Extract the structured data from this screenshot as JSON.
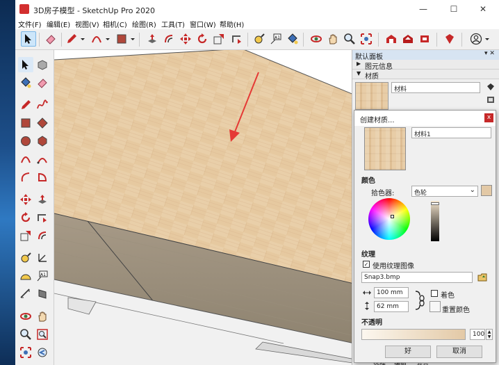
{
  "window": {
    "title": "3D房子模型 - SketchUp Pro 2020",
    "minimize_icon": "—",
    "maximize_icon": "☐",
    "close_icon": "✕"
  },
  "menu": [
    "文件(F)",
    "编辑(E)",
    "视图(V)",
    "相机(C)",
    "绘图(R)",
    "工具(T)",
    "窗口(W)",
    "帮助(H)"
  ],
  "tray": {
    "title": "默认面板",
    "entity_info": "图元信息",
    "materials": "材质",
    "material_name": "材料",
    "controls": "▾ ✕"
  },
  "dialog": {
    "title": "创建材质...",
    "close": "x",
    "name_value": "材料1",
    "color_section": "颜色",
    "picker_label": "拾色器:",
    "picker_value": "色轮",
    "texture_section": "纹理",
    "use_texture_label": "使用纹理图像",
    "use_texture_checked": true,
    "texture_file": "Snap3.bmp",
    "width_value": "100 mm",
    "height_value": "62 mm",
    "colorize_label": "着色",
    "reset_color_label": "重置颜色",
    "opacity_section": "不透明",
    "opacity_value": "100",
    "ok_label": "好",
    "cancel_label": "取消",
    "swatch_color": "#e3c9a6"
  },
  "bottom_tabs": [
    "选择",
    "编辑",
    "混合"
  ],
  "colors": {
    "annotation_arrow": "#e53935",
    "wood": "#e6c9a0",
    "side_panel": "#9d9281"
  }
}
